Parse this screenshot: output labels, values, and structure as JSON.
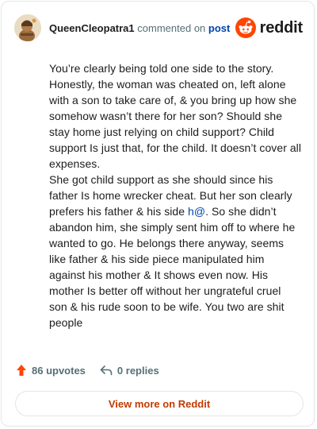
{
  "header": {
    "username": "QueenCleopatra1",
    "action_text": "commented on",
    "post_link": "post",
    "brand": "reddit",
    "avatar_icon": "avatar-icon",
    "brand_icon": "reddit-alien-icon"
  },
  "comment": {
    "paragraph1": "You’re clearly being told one side to the story. Honestly, the woman was cheated on, left alone with a son to take care of, & you bring up how she somehow wasn’t there for her son? Should she stay home just relying on child support? Child support Is just that, for the child. It doesn’t cover all expenses.",
    "paragraph2_before": "She got child support as she should since his father Is home wrecker cheat. But her son clearly prefers his father & his side ",
    "paragraph2_link": "h@",
    "paragraph2_after": ". So she didn’t abandon him, she simply sent him off to where he wanted to go. He belongs there anyway, seems like father & his side piece manipulated him against his mother & It shows even now. His mother Is better off without her ungrateful cruel son & his rude soon to be wife. You two are shit people"
  },
  "footer": {
    "upvotes": "86 upvotes",
    "replies": "0 replies",
    "upvote_icon": "upvote-arrow-icon",
    "reply_icon": "reply-arrow-icon"
  },
  "cta": {
    "label": "View more on Reddit"
  },
  "colors": {
    "accent": "#ff4500",
    "link": "#0045ac",
    "cta_text": "#c33a00",
    "muted": "#576f76"
  }
}
